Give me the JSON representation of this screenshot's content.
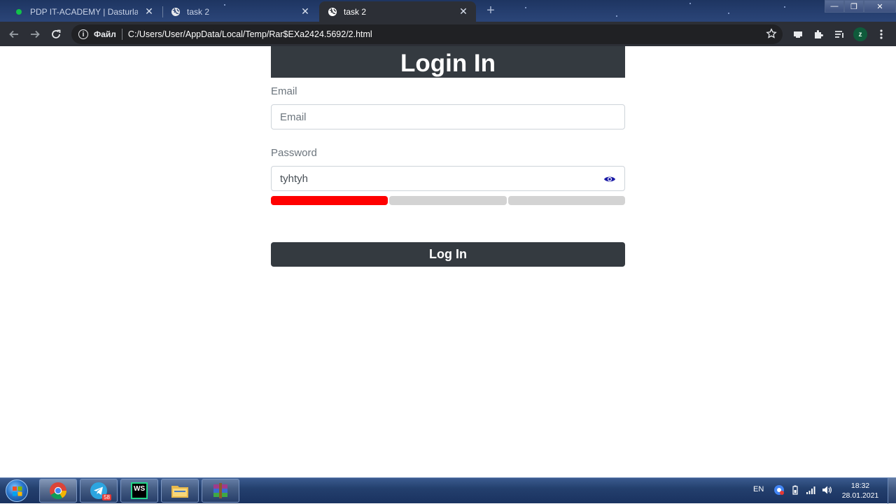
{
  "browser": {
    "tabs": [
      {
        "title": "PDP IT-ACADEMY | Dasturlashni",
        "state": "inactive",
        "favicon": "green-dot-icon"
      },
      {
        "title": "task 2",
        "state": "inactive",
        "favicon": "globe-icon"
      },
      {
        "title": "task 2",
        "state": "active",
        "favicon": "globe-icon"
      }
    ],
    "new_tab_symbol": "+",
    "window_controls": {
      "minimize": "—",
      "restore": "❐",
      "close": "✕"
    },
    "scheme_label": "Файл",
    "url": "C:/Users/User/AppData/Local/Temp/Rar$EXa2424.5692/2.html",
    "profile_initial": "z"
  },
  "page": {
    "heading": "Login In",
    "email": {
      "label": "Email",
      "placeholder": "Email",
      "value": ""
    },
    "password": {
      "label": "Password",
      "value": "tyhtyh"
    },
    "strength": {
      "segments": 3,
      "filled": 1,
      "color": "#ff0000"
    },
    "login_button": "Log In"
  },
  "taskbar": {
    "apps": [
      {
        "name": "chrome",
        "active": true
      },
      {
        "name": "telegram",
        "badge": "58"
      },
      {
        "name": "webstorm",
        "label": "WS"
      },
      {
        "name": "explorer"
      },
      {
        "name": "winrar"
      }
    ],
    "language": "EN",
    "time": "18:32",
    "date": "28.01.2021"
  },
  "colors": {
    "heading_bg": "#343a40",
    "button_bg": "#343a40",
    "eye_icon": "#1a1aa6",
    "strength_on": "#ff0000",
    "strength_off": "#d3d3d3"
  }
}
